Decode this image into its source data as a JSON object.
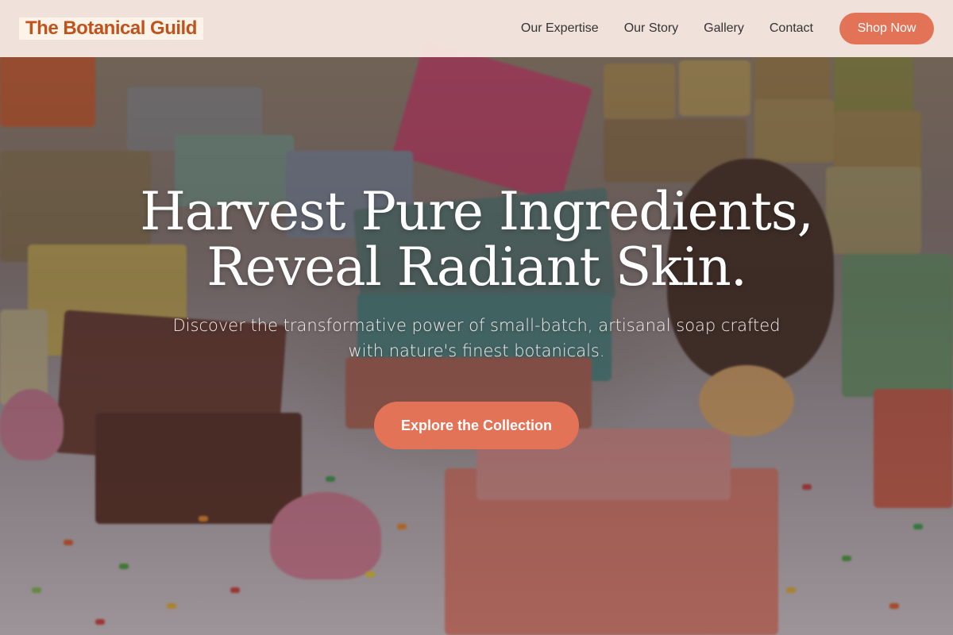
{
  "header": {
    "logo_text": "The Botanical Guild",
    "nav": [
      {
        "label": "Our Expertise"
      },
      {
        "label": "Our Story"
      },
      {
        "label": "Gallery"
      },
      {
        "label": "Contact"
      }
    ],
    "shop_button": "Shop Now"
  },
  "hero": {
    "headline_line1": "Harvest Pure Ingredients,",
    "headline_line2": "Reveal Radiant Skin.",
    "subheadline": "Discover the transformative power of small-batch, artisanal soap crafted with nature's finest botanicals.",
    "cta_button": "Explore the Collection"
  },
  "colors": {
    "accent": "#e37357",
    "logo": "#c0531c",
    "header_bg": "#faece4"
  }
}
